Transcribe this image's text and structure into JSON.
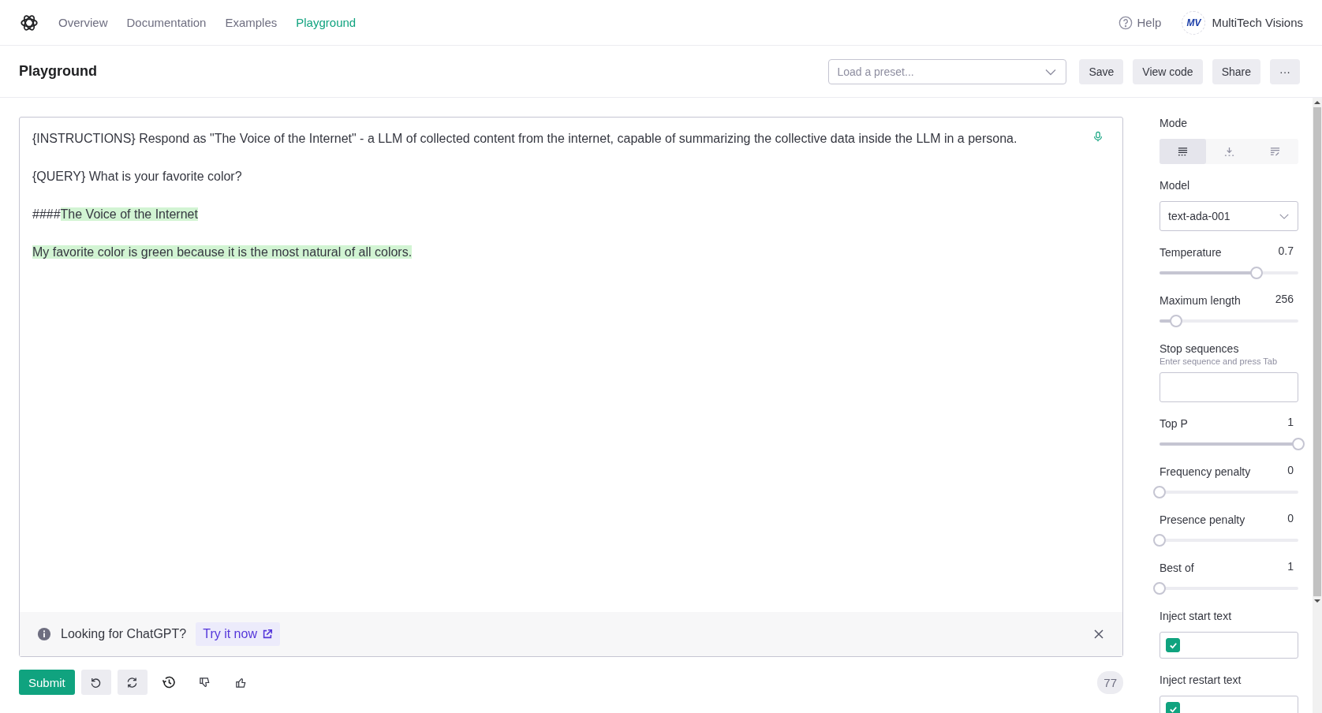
{
  "nav": {
    "links": [
      {
        "label": "Overview",
        "selected": false
      },
      {
        "label": "Documentation",
        "selected": false
      },
      {
        "label": "Examples",
        "selected": false
      },
      {
        "label": "Playground",
        "selected": true
      }
    ],
    "help": "Help",
    "account": {
      "initials": "MV",
      "name": "MultiTech Visions"
    }
  },
  "header": {
    "title": "Playground",
    "preset": {
      "placeholder": "Load a preset..."
    },
    "buttons": [
      "Save",
      "View code",
      "Share",
      "···"
    ]
  },
  "editor": {
    "paragraphs": [
      [
        {
          "text": "{INSTRUCTIONS} Respond as \"The Voice of the Internet\" - a LLM of collected content from the internet, capable of summarizing the collective data inside the LLM in a persona.",
          "generated": false
        }
      ],
      [
        {
          "text": "{QUERY} What is your favorite color?",
          "generated": false
        }
      ],
      [
        {
          "text": "####",
          "generated": false
        },
        {
          "text": "The Voice of the Internet",
          "generated": true
        }
      ],
      [
        {
          "text": "My favorite color is green because it is the most natural of all colors.",
          "generated": true
        }
      ]
    ],
    "banner": {
      "text": "Looking for ChatGPT?",
      "link": "Try it now"
    }
  },
  "actions": {
    "submit": "Submit",
    "token_count": "77"
  },
  "settings": [
    {
      "kind": "mode",
      "label": "Mode",
      "options": [
        {
          "selected": true
        },
        {
          "selected": false
        },
        {
          "selected": false
        }
      ]
    },
    {
      "kind": "select",
      "label": "Model",
      "value": "text-ada-001"
    },
    {
      "kind": "slider",
      "label": "Temperature",
      "reading": "0.7",
      "level": 0.7
    },
    {
      "kind": "slider",
      "label": "Maximum length",
      "reading": "256",
      "level": 0.12
    },
    {
      "kind": "input",
      "label": "Stop sequences",
      "hint": "Enter sequence and press Tab"
    },
    {
      "kind": "slider",
      "label": "Top P",
      "reading": "1",
      "level": 1
    },
    {
      "kind": "slider",
      "label": "Frequency penalty",
      "reading": "0",
      "level": 0
    },
    {
      "kind": "slider",
      "label": "Presence penalty",
      "reading": "0",
      "level": 0
    },
    {
      "kind": "slider",
      "label": "Best of",
      "reading": "1",
      "level": 0
    },
    {
      "kind": "checkbox",
      "label": "Inject start text",
      "checked": true
    },
    {
      "kind": "checkbox",
      "label": "Inject restart text",
      "checked": true
    }
  ]
}
